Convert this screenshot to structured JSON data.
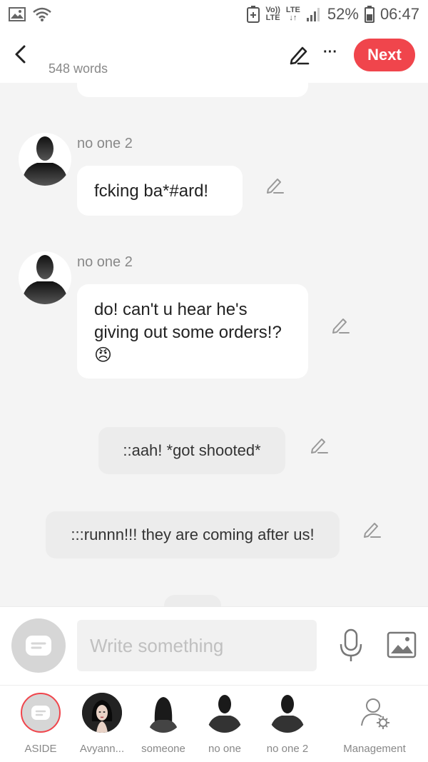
{
  "status_bar": {
    "volte_top": "Vo))",
    "volte_bottom": "LTE",
    "lte": "LTE",
    "battery": "52%",
    "time": "06:47"
  },
  "header": {
    "word_count": "548 words",
    "next_label": "Next"
  },
  "messages": [
    {
      "sender": "no one 2",
      "text": "fcking ba*#ard!"
    },
    {
      "sender": "no one 2",
      "text": "do! can't u hear he's giving out some orders!?",
      "emoji": "😠"
    }
  ],
  "asides": [
    "::aah! *got shooted*",
    ":::runnn!!! they are coming after us!"
  ],
  "input": {
    "placeholder": "Write something"
  },
  "characters": [
    {
      "label": "ASIDE"
    },
    {
      "label": "Avyann..."
    },
    {
      "label": "someone"
    },
    {
      "label": "no one"
    },
    {
      "label": "no one 2"
    },
    {
      "label": "Management"
    }
  ],
  "colors": {
    "accent": "#f0454c",
    "background": "#f4f4f4",
    "aside_bubble": "#ececec"
  }
}
